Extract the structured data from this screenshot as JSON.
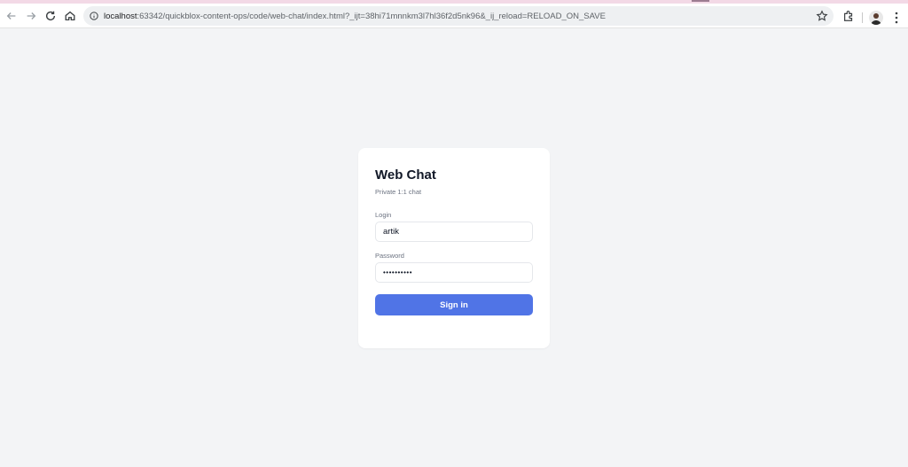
{
  "browser": {
    "url_host": "localhost",
    "url_rest": ":63342/quickblox-content-ops/code/web-chat/index.html?_ijt=38hi71mnnkm3l7hl36f2d5nk96&_ij_reload=RELOAD_ON_SAVE",
    "icons": [
      "back-icon",
      "forward-icon",
      "reload-icon",
      "home-icon",
      "info-icon",
      "star-icon",
      "extensions-icon",
      "avatar",
      "menu-icon"
    ]
  },
  "login": {
    "title": "Web Chat",
    "subtitle": "Private 1:1 chat",
    "login_label": "Login",
    "login_value": "artik",
    "password_label": "Password",
    "password_value": "••••••••••",
    "signin_label": "Sign in"
  },
  "colors": {
    "page_background": "#f3f4f6",
    "card_background": "#ffffff",
    "button_accent": "#5074e6"
  }
}
